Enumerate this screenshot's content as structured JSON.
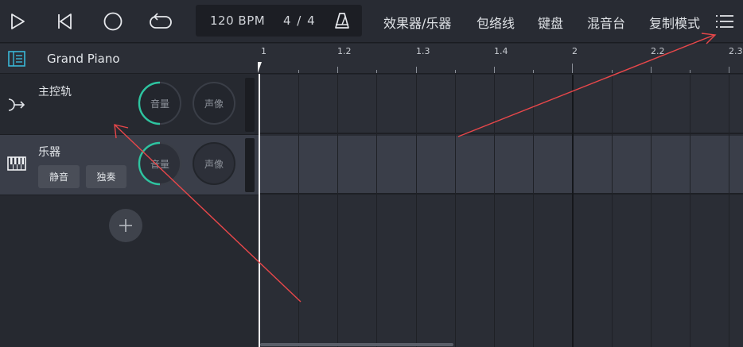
{
  "toolbar": {
    "bpm": "120 BPM",
    "time_signature": "4 / 4",
    "menu": [
      "效果器/乐器",
      "包络线",
      "键盘",
      "混音台",
      "复制模式"
    ],
    "icons": [
      "play-icon",
      "skip-back-icon",
      "record-icon",
      "loop-icon",
      "metronome-icon",
      "hamburger-menu-icon"
    ]
  },
  "instrument": {
    "name": "Grand Piano"
  },
  "tracks": [
    {
      "name": "主控轨",
      "volume_label": "音量",
      "pan_label": "声像"
    },
    {
      "name": "乐器",
      "mute_label": "静音",
      "solo_label": "独奏",
      "volume_label": "音量",
      "pan_label": "声像"
    }
  ],
  "ruler": {
    "labels": [
      "1",
      "1.2",
      "1.3",
      "1.4",
      "2",
      "2.2",
      "2.3"
    ]
  },
  "colors": {
    "accent": "#2ec4a0",
    "arrow": "#e8474a",
    "background": "#22252c"
  }
}
